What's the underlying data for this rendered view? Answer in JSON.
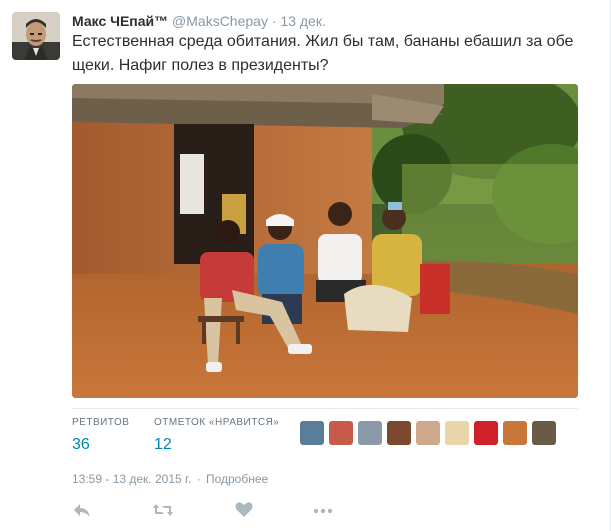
{
  "tweet": {
    "fullname": "Макс ЧЕпай™",
    "username": "@MaksChepay",
    "separator": "·",
    "date": "13 дек.",
    "text_line1": "Естественная среда обитания. Жил бы там, бананы ебашил за обе",
    "text_line2": "щеки. Нафиг полез в президенты?"
  },
  "stats": {
    "retweets_label": "РЕТВИТОВ",
    "retweets_count": "36",
    "likes_label": "ОТМЕТОК «НРАВИТСЯ»",
    "likes_count": "12",
    "liker_colors": [
      "#5a7d99",
      "#c85a4a",
      "#8a9aa8",
      "#7b4a2e",
      "#cfa78a",
      "#e8d5a8",
      "#d0202a",
      "#c9763a",
      "#6b5a48"
    ]
  },
  "meta": {
    "timestamp": "13:59 - 13 дек. 2015 г.",
    "separator": "·",
    "details_link": "Подробнее"
  },
  "colors": {
    "link": "#0084b4",
    "muted": "#8899a6",
    "action_icon": "#aab8c2",
    "border": "#e6ecf0"
  },
  "icons": {
    "reply": "reply-icon",
    "retweet": "retweet-icon",
    "like": "heart-icon",
    "more": "more-icon"
  }
}
